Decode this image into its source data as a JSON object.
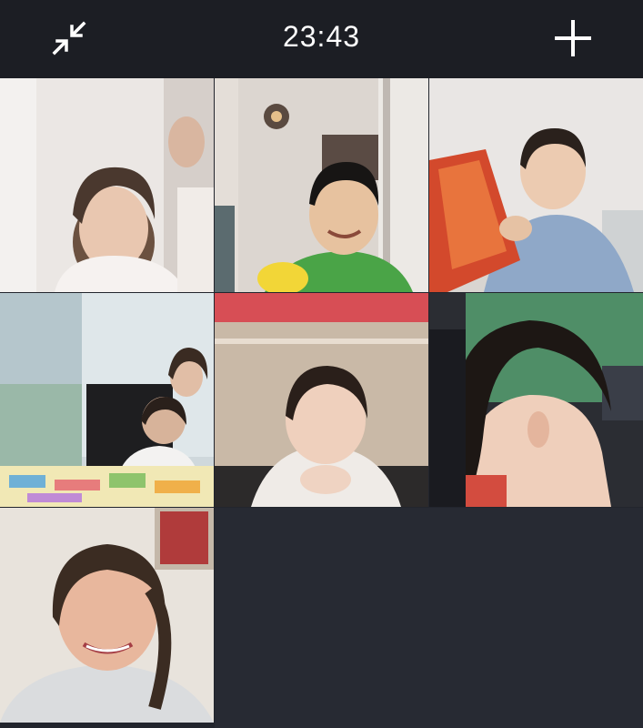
{
  "call": {
    "duration": "23:43"
  },
  "toolbar": {
    "minimize_icon": "collapse-arrows-icon",
    "add_icon": "plus-icon"
  },
  "participants": [
    {
      "id": 1,
      "desc_color": "#d9d3cf"
    },
    {
      "id": 2,
      "desc_color": "#cfcac4"
    },
    {
      "id": 3,
      "desc_color": "#e0dcd8"
    },
    {
      "id": 4,
      "desc_color": "#b8c7cc"
    },
    {
      "id": 5,
      "desc_color": "#2b2624"
    },
    {
      "id": 6,
      "desc_color": "#1a1c22"
    },
    {
      "id": 7,
      "desc_color": "#e2ddd6"
    }
  ],
  "colors": {
    "background": "#22252d",
    "topbar": "#1c1e24",
    "text": "#ffffff"
  }
}
